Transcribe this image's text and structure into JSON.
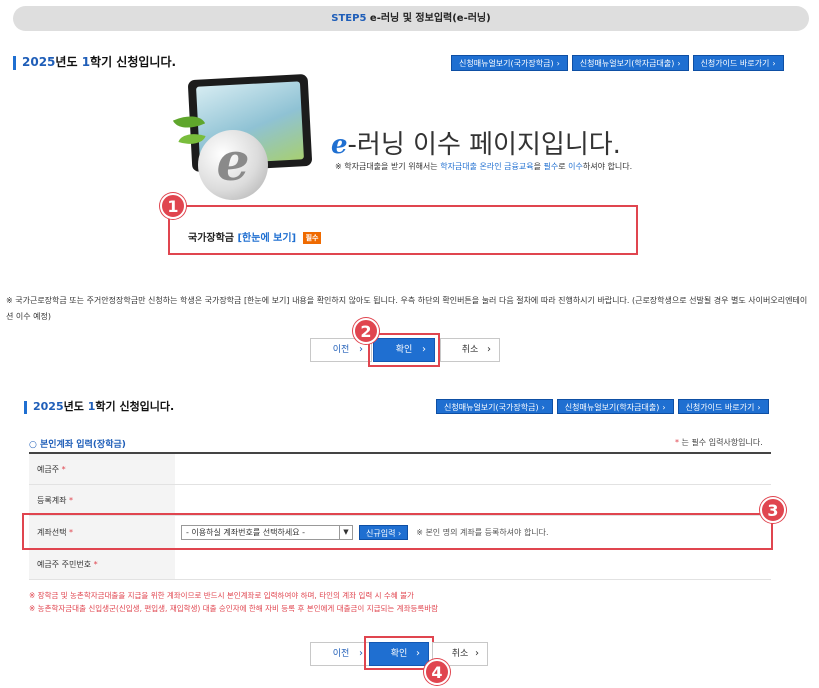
{
  "banner": {
    "step_no": "STEP5",
    "step_text": "e-러닝 및 정보입력(e-러닝)"
  },
  "section1": {
    "year": "2025",
    "year_suffix": "년도",
    "semester_num": "1",
    "semester_suffix": "학기 신청입니다.",
    "buttons": [
      "신청매뉴얼보기(국가장학금)",
      "신청매뉴얼보기(학자금대출)",
      "신청가이드 바로가기"
    ]
  },
  "hero": {
    "e_letter": "e",
    "title_rest": "-러닝 이수 페이지입니다.",
    "note_prefix": "※ 학자금대출을 받기 위해서는 ",
    "note_hl1": "학자금대출 온라인 금융교육",
    "note_mid": "을 ",
    "note_hl2": "필수",
    "note_mid2": "로 ",
    "note_hl3": "이수",
    "note_suffix": "하셔야 합니다."
  },
  "national": {
    "label": "국가장학금",
    "link": "[한눈에 보기]",
    "badge": "필수"
  },
  "badges": [
    "1",
    "2",
    "3",
    "4"
  ],
  "notice": "※ 국가근로장학금 또는 주거안정장학금만 신청하는 학생은 국가장학금 [한눈에 보기] 내용을 확인하지 않아도 됩니다. 우측 하단의 확인버튼을 눌러 다음 절차에 따라 진행하시기 바랍니다. (근로장학생으로 선발될 경우 별도 사이버오리엔테이션 이수 예정)",
  "nav1": {
    "prev": "이전",
    "confirm": "확인",
    "cancel": "취소"
  },
  "section2": {
    "year": "2025",
    "year_suffix": "년도",
    "semester_num": "1",
    "semester_suffix": "학기 신청입니다.",
    "buttons": [
      "신청매뉴얼보기(국가장학금)",
      "신청매뉴얼보기(학자금대출)",
      "신청가이드 바로가기"
    ]
  },
  "account": {
    "title": "본인계좌 입력(장학금)",
    "required_note": "는 필수 입력사항입니다.",
    "rows": [
      {
        "label": "예금주"
      },
      {
        "label": "등록계좌"
      },
      {
        "label": "계좌선택"
      },
      {
        "label": "예금주 주민번호"
      }
    ],
    "select_value": "- 이용하실 계좌번호를 선택하세요 -",
    "new_button": "신규입력",
    "acct_note": "※ 본인 명의 계좌를 등록하셔야 합니다.",
    "red_notes": [
      "※ 장학금 및 농촌학자금대출을 지급을 위한 계좌이므로 반드시 본인계좌로 입력하여야 하며, 타인의 계좌 입력 시 수혜 불가",
      "※ 농촌학자금대출 신입생군(신입생, 편입생, 재입학생) 대출 승인자에 한해 자비 등록 후 본인에게 대출금이 지급되는 계좌등록바람"
    ]
  },
  "nav2": {
    "prev": "이전",
    "confirm": "확인",
    "cancel": "취소"
  }
}
